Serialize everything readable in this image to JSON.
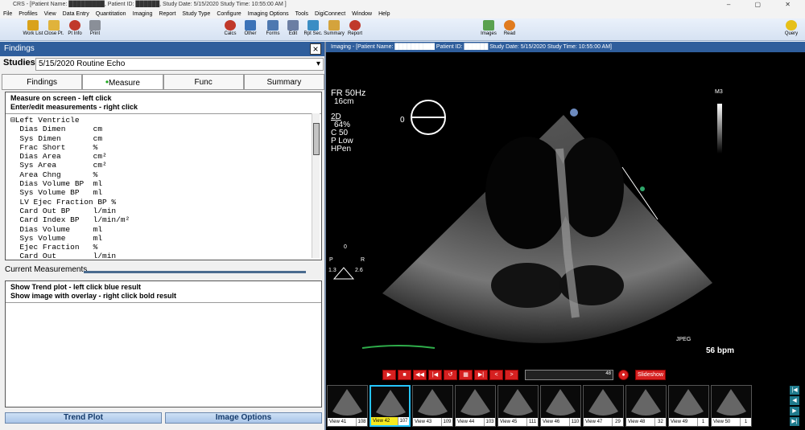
{
  "window": {
    "title": "CRS - [Patient Name: █████████, Patient ID: ██████, Study Date: 5/15/2020  Study Time: 10:55:00 AM ]"
  },
  "menu": [
    "File",
    "Profiles",
    "View",
    "Data Entry",
    "Quantitation",
    "Imaging",
    "Report",
    "Study Type",
    "Configure",
    "Imaging Options",
    "Tools",
    "DigiConnect",
    "Window",
    "Help"
  ],
  "toolbar": {
    "left": [
      "Work List",
      "Close Pt.",
      "Pt Info",
      "Print"
    ],
    "mid": [
      "Calcs",
      "Other",
      "Forms",
      "Edit",
      "Rpt Sec.",
      "Summary",
      "Report"
    ],
    "right": [
      "Images",
      "Read"
    ],
    "far_right": "Query"
  },
  "findings": {
    "title": "Findings",
    "studies_label": "Studies",
    "study_value": "5/15/2020   Routine Echo",
    "tabs": [
      "Findings",
      "Measure",
      "Func",
      "Summary"
    ],
    "active_tab_index": 1,
    "measure_hint_1": "Measure on screen - left click",
    "measure_hint_2": "Enter/edit measurements - right click",
    "tree_root": "Left Ventricle",
    "tree_items": [
      "Dias Dimen      cm",
      "Sys Dimen       cm",
      "Frac Short      %",
      "Dias Area       cm²",
      "Sys Area        cm²",
      "Area Chng       %",
      "Dias Volume BP  ml",
      "Sys Volume BP   ml",
      "LV Ejec Fraction BP %",
      "Card Out BP     l/min",
      "Card Index BP   l/min/m²",
      "Dias Volume     ml",
      "Sys Volume      ml",
      "Ejec Fraction   %",
      "Card Out        l/min"
    ],
    "current_measurements": "Current Measurements",
    "trend_hint_1": "Show Trend plot - left click blue result",
    "trend_hint_2": "Show image with overlay - right click bold result",
    "trend_plot_button": "Trend Plot",
    "image_options_button": "Image Options"
  },
  "imaging": {
    "header": "Imaging - [Patient Name: ██████████   Patient ID: ██████   Study Date: 5/15/2020   Study Time: 10:55:00 AM]",
    "fr": "FR 50Hz",
    "depth": "16cm",
    "mode_2d": "2D",
    "gain": "64%",
    "compress": "C 50",
    "power": "P Low",
    "harmonic": "HPen",
    "angle": "0",
    "m_label": "M3",
    "jpeg": "JPEG",
    "bpm": "56 bpm",
    "probe_labels": [
      "0",
      "P",
      "R",
      "1.3",
      "2.6"
    ],
    "slider_value": "48",
    "slideshow": "Slideshow"
  },
  "thumbnails": [
    {
      "label": "View 41",
      "count": "108"
    },
    {
      "label": "View 42",
      "count": "107"
    },
    {
      "label": "View 43",
      "count": "109"
    },
    {
      "label": "View 44",
      "count": "103"
    },
    {
      "label": "View 45",
      "count": "111"
    },
    {
      "label": "View 46",
      "count": "110"
    },
    {
      "label": "View 47",
      "count": "29"
    },
    {
      "label": "View 48",
      "count": "32"
    },
    {
      "label": "View 49",
      "count": "1"
    },
    {
      "label": "View 50",
      "count": "1"
    }
  ],
  "selected_thumbnail_index": 1,
  "colors": {
    "panel_header": "#2f5e9c",
    "selected_thumb_border": "#25c4ff",
    "selected_thumb_label": "#f6ea20",
    "playback_red": "#d62020"
  }
}
